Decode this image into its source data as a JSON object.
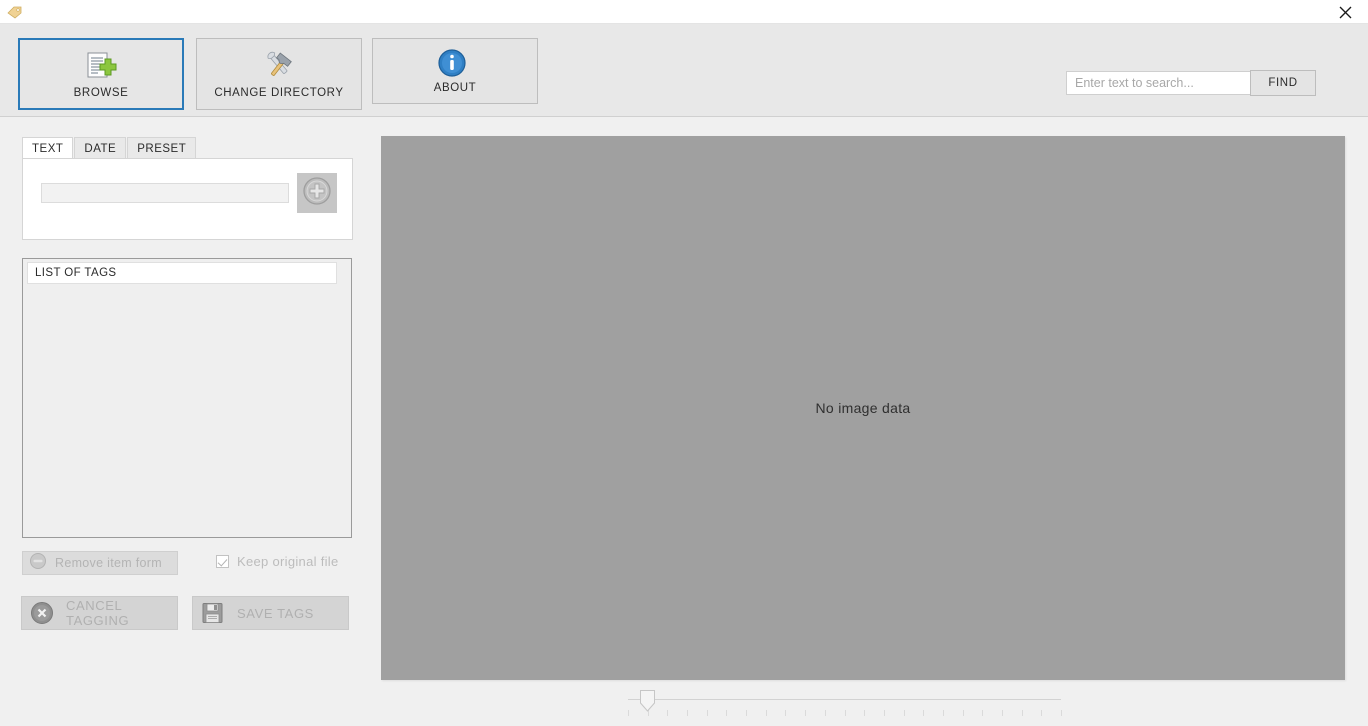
{
  "window": {
    "app_icon": "tag-icon",
    "close_icon": "close-icon"
  },
  "toolbar": {
    "buttons": [
      {
        "label": "BROWSE",
        "icon": "document-add-icon",
        "active": true
      },
      {
        "label": "CHANGE DIRECTORY",
        "icon": "tools-wrench-hammer-icon",
        "active": false
      },
      {
        "label": "ABOUT",
        "icon": "info-circle-icon",
        "active": false
      }
    ],
    "search": {
      "placeholder": "Enter text to search...",
      "value": "",
      "icon": "search-icon"
    },
    "find_label": "FIND"
  },
  "left_panel": {
    "tabs": [
      {
        "label": "TEXT",
        "active": true
      },
      {
        "label": "DATE",
        "active": false
      },
      {
        "label": "PRESET",
        "active": false
      }
    ],
    "tag_input": {
      "value": "",
      "placeholder": ""
    },
    "add_button": {
      "icon": "plus-circle-icon",
      "label": ""
    },
    "taglist": {
      "header": "LIST OF TAGS",
      "items": []
    },
    "remove_button": {
      "label": "Remove item form",
      "icon": "minus-circle-icon",
      "enabled": false
    },
    "keep_original": {
      "label": "Keep original file",
      "checked": true,
      "enabled": false
    },
    "cancel_button": {
      "label": "CANCEL TAGGING",
      "icon": "cancel-x-circle-icon",
      "enabled": false
    },
    "save_button": {
      "label": "SAVE TAGS",
      "icon": "floppy-save-icon",
      "enabled": false
    }
  },
  "viewer": {
    "empty_message": "No image data"
  },
  "slider": {
    "value": 1,
    "min": 0,
    "max": 23,
    "tick_count": 23
  },
  "colors": {
    "accent": "#2a7ab8",
    "toolbar_bg": "#e8e8e8",
    "panel_bg": "#f0f0f0",
    "viewer_bg": "#a0a0a0",
    "disabled_text": "#b4b4b4"
  }
}
